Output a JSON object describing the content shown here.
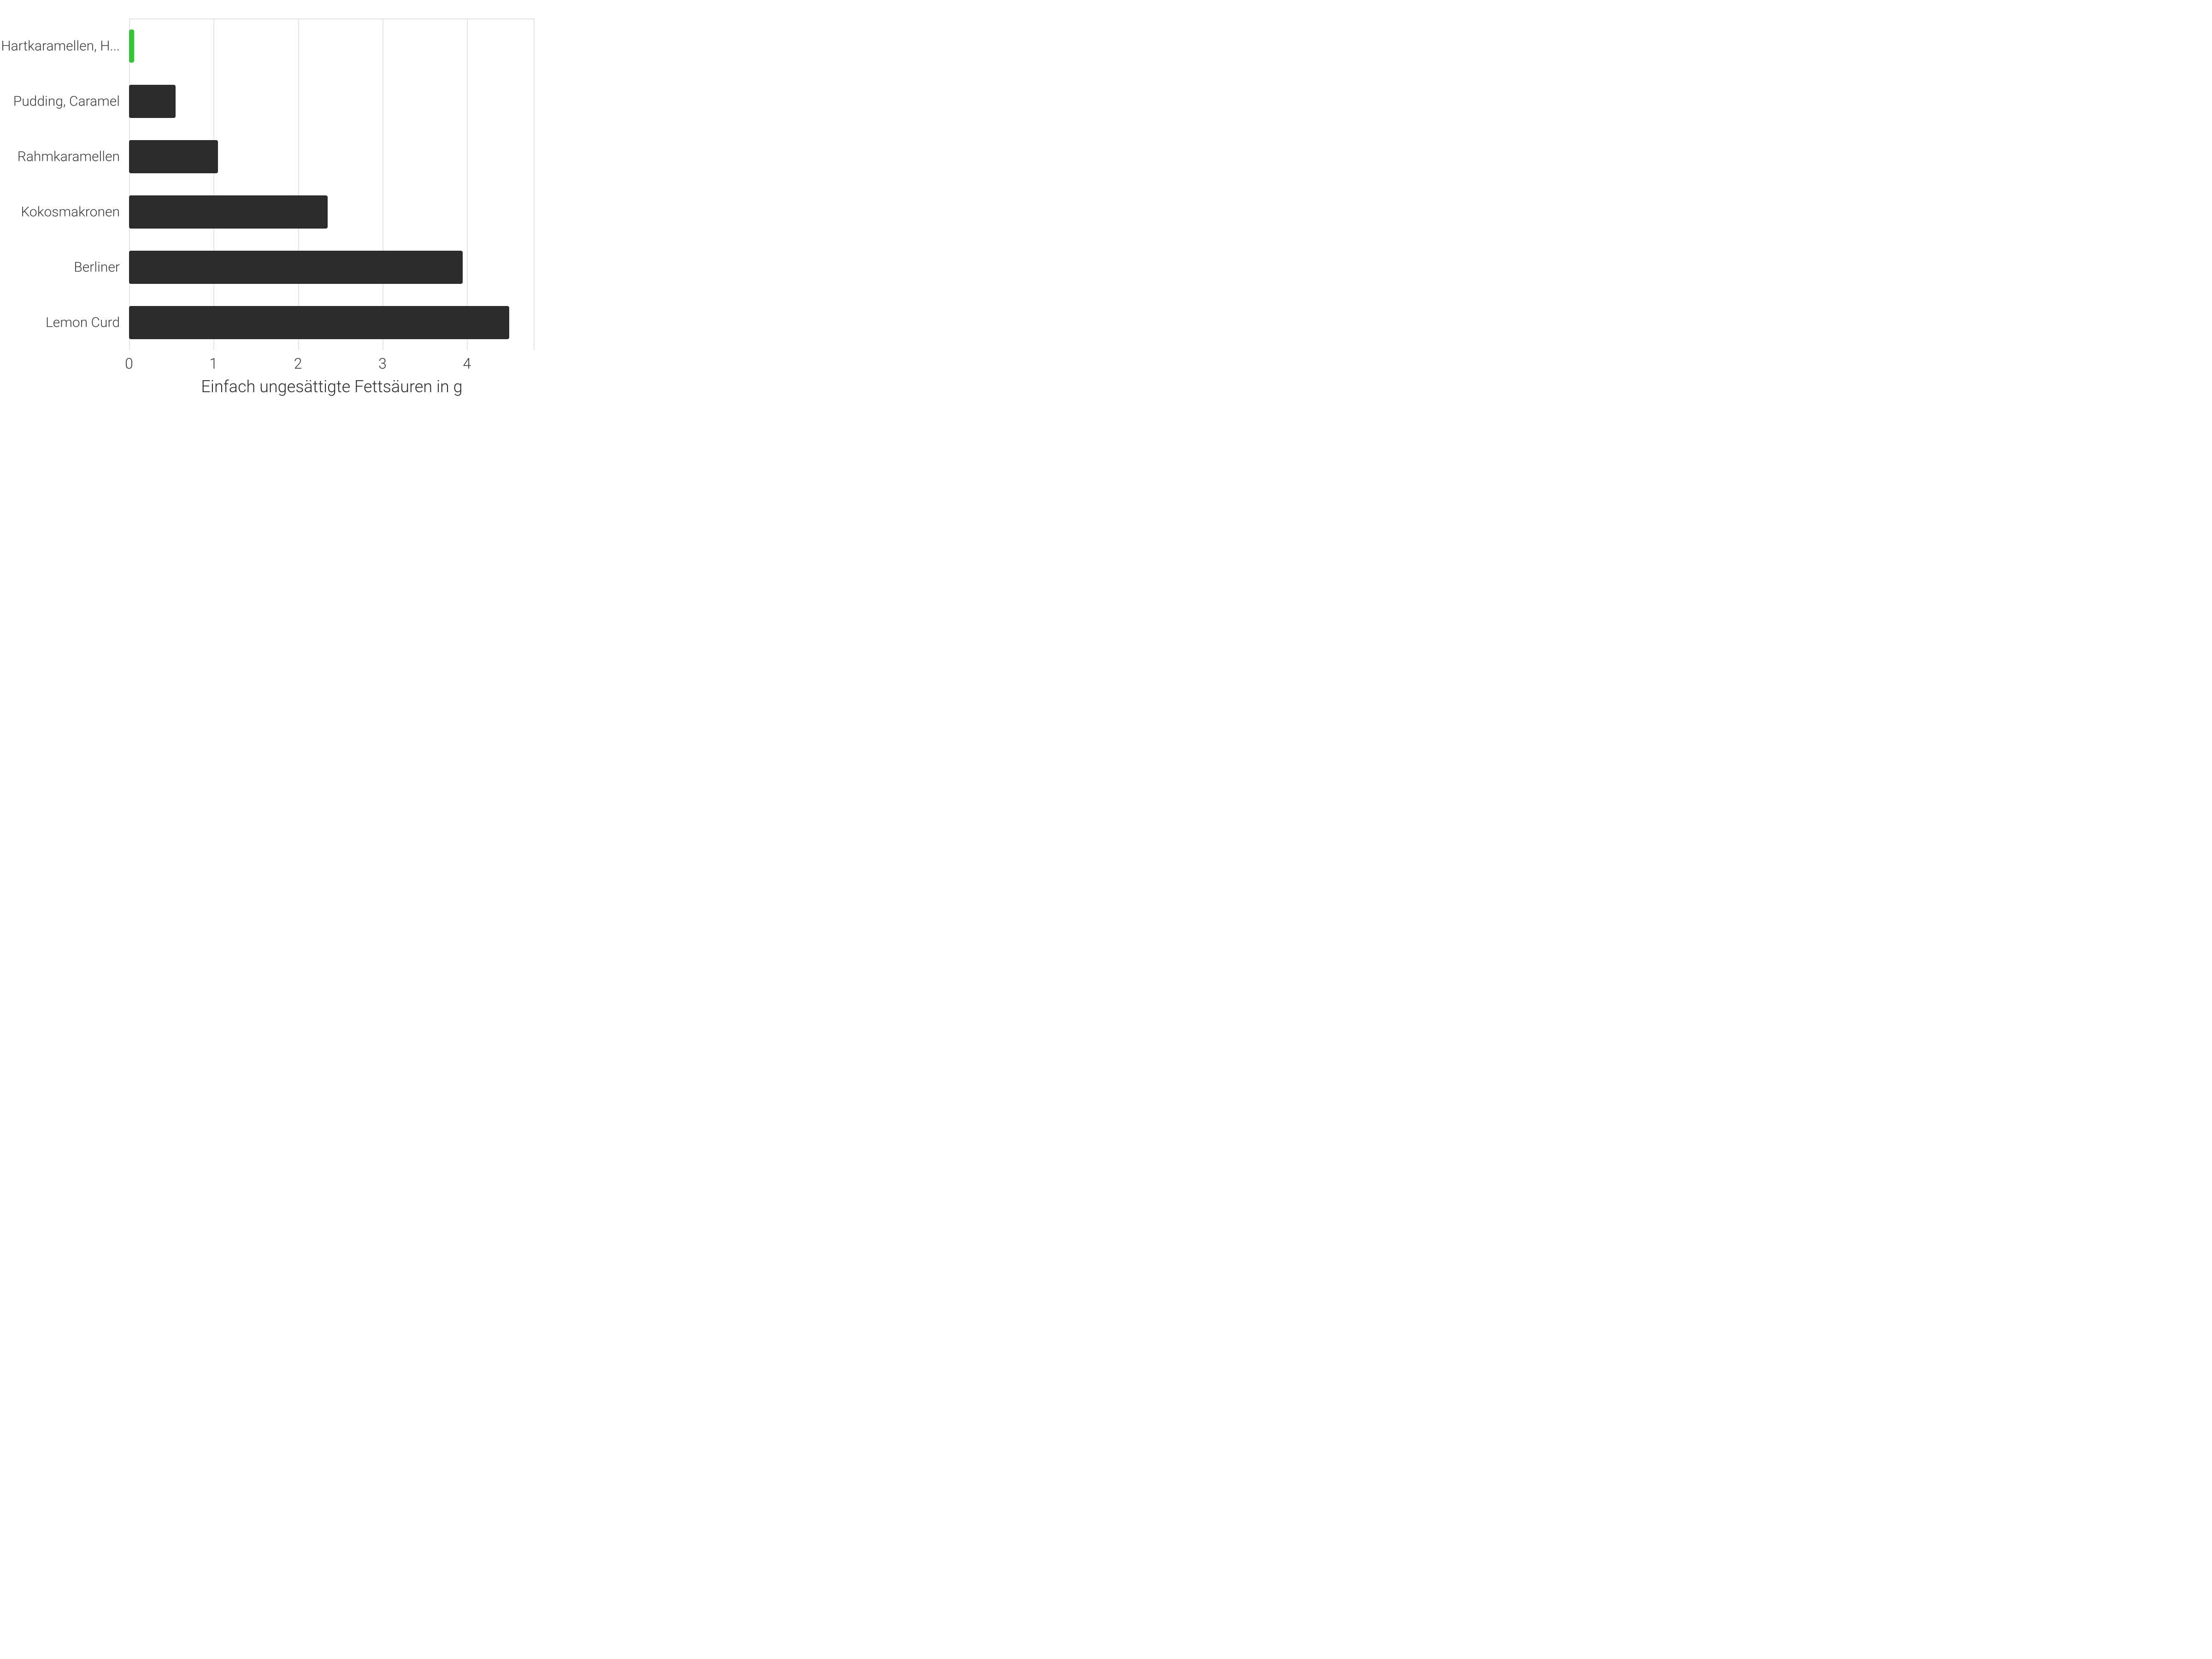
{
  "chart_data": {
    "type": "bar",
    "orientation": "horizontal",
    "categories": [
      "Hartkaramellen, H...",
      "Pudding, Caramel",
      "Rahmkaramellen",
      "Kokosmakronen",
      "Berliner",
      "Lemon Curd"
    ],
    "values": [
      0.06,
      0.55,
      1.05,
      2.35,
      3.95,
      4.5
    ],
    "highlight_index": 0,
    "xlabel": "Einfach ungesättigte Fettsäuren in g",
    "ylabel": "",
    "xlim": [
      0,
      4.8
    ],
    "x_ticks": [
      0,
      1,
      2,
      3,
      4
    ],
    "colors": {
      "default": "#2b2b2b",
      "highlight": "#3ac13a"
    }
  }
}
